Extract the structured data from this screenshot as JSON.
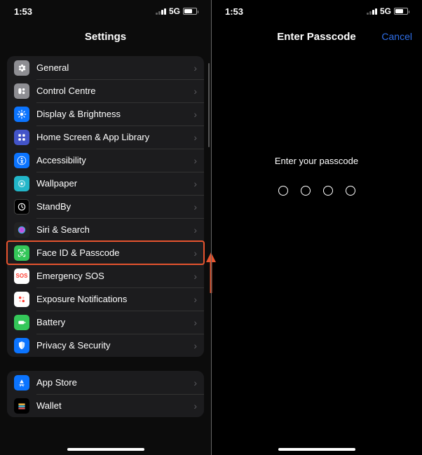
{
  "status": {
    "time": "1:53",
    "network": "5G"
  },
  "left": {
    "title": "Settings",
    "groups": [
      [
        {
          "key": "general",
          "label": "General",
          "iconBg": "#8e8e93"
        },
        {
          "key": "control-centre",
          "label": "Control Centre",
          "iconBg": "#8e8e93"
        },
        {
          "key": "display",
          "label": "Display & Brightness",
          "iconBg": "#0b74ff"
        },
        {
          "key": "home-screen",
          "label": "Home Screen & App Library",
          "iconBg": "#4354c8"
        },
        {
          "key": "accessibility",
          "label": "Accessibility",
          "iconBg": "#0b74ff"
        },
        {
          "key": "wallpaper",
          "label": "Wallpaper",
          "iconBg": "#22b6c9"
        },
        {
          "key": "standby",
          "label": "StandBy",
          "iconBg": "#000000"
        },
        {
          "key": "siri",
          "label": "Siri & Search",
          "iconBg": "#232323"
        },
        {
          "key": "faceid",
          "label": "Face ID & Passcode",
          "iconBg": "#34c759",
          "highlighted": true
        },
        {
          "key": "sos",
          "label": "Emergency SOS",
          "iconBg": "#ffffff",
          "iconText": "SOS",
          "iconTextColor": "#ff3b30"
        },
        {
          "key": "exposure",
          "label": "Exposure Notifications",
          "iconBg": "#ffffff"
        },
        {
          "key": "battery",
          "label": "Battery",
          "iconBg": "#34c759"
        },
        {
          "key": "privacy",
          "label": "Privacy & Security",
          "iconBg": "#0b74ff"
        }
      ],
      [
        {
          "key": "appstore",
          "label": "App Store",
          "iconBg": "#0b74ff"
        },
        {
          "key": "wallet",
          "label": "Wallet",
          "iconBg": "#000000"
        }
      ]
    ]
  },
  "right": {
    "title": "Enter Passcode",
    "cancel": "Cancel",
    "cancelColor": "#2f6fe8",
    "prompt": "Enter your passcode",
    "dots": 4
  },
  "annotation": {
    "arrowColor": "#e6542f"
  }
}
